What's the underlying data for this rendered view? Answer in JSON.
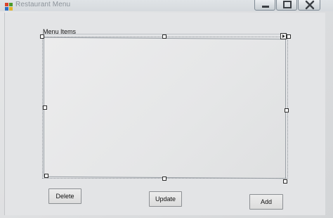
{
  "window": {
    "title": "Restaurant Menu",
    "controls": {
      "minimize_icon": "minimize-icon",
      "maximize_icon": "maximize-icon",
      "close_icon": "close-icon"
    }
  },
  "menu_group": {
    "label": "Menu Items",
    "items": []
  },
  "buttons": {
    "delete_label": "Delete",
    "update_label": "Update",
    "add_label": "Add"
  },
  "colors": {
    "titlebar_text": "#8d949b",
    "form_background": "#e3e4e6",
    "selection_handle": "#ffffff"
  }
}
